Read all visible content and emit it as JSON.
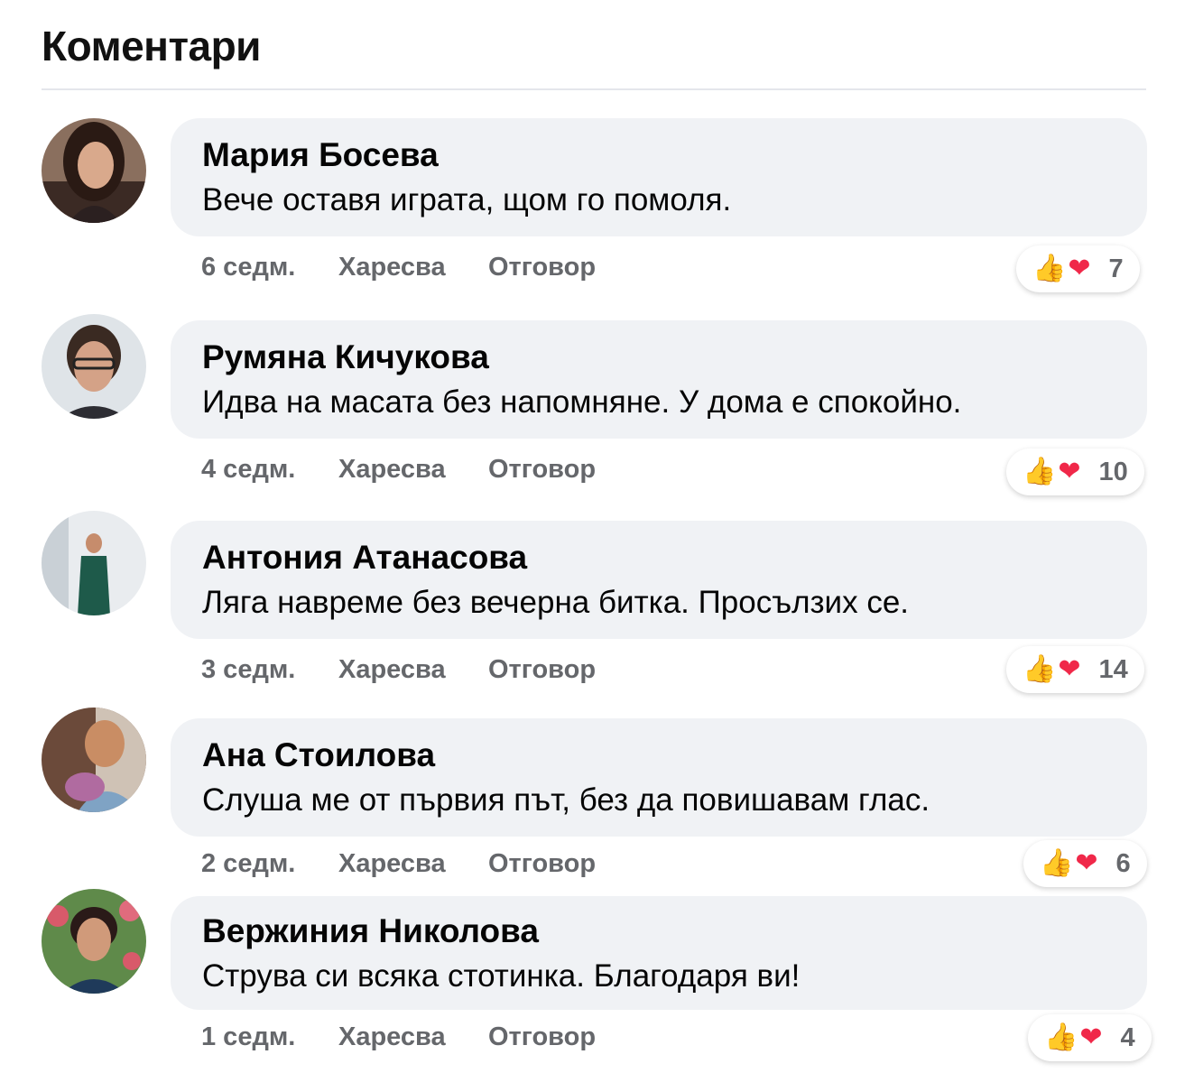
{
  "header": {
    "title": "Коментари"
  },
  "labels": {
    "like": "Харесва",
    "reply": "Отговор"
  },
  "comments": [
    {
      "author": "Мария Босева",
      "text": "Вече оставя играта, щом го помоля.",
      "time": "6 седм.",
      "reactions": {
        "count": "7",
        "icons": [
          "thumbs-up",
          "heart"
        ]
      }
    },
    {
      "author": "Румяна Кичукова",
      "text": "Идва на масата без напомняне. У дома е спокойно.",
      "time": "4 седм.",
      "reactions": {
        "count": "10",
        "icons": [
          "thumbs-up",
          "heart"
        ]
      }
    },
    {
      "author": "Антония Атанасова",
      "text": "Ляга навреме без вечерна битка. Просълзих се.",
      "time": "3 седм.",
      "reactions": {
        "count": "14",
        "icons": [
          "thumbs-up",
          "heart"
        ]
      }
    },
    {
      "author": "Ана Стоилова",
      "text": "Слуша ме от първия път, без да повишавам глас.",
      "time": "2 седм.",
      "reactions": {
        "count": "6",
        "icons": [
          "thumbs-up",
          "heart"
        ]
      }
    },
    {
      "author": "Вержиния Николова",
      "text": "Струва си всяка стотинка. Благодаря ви!",
      "time": "1 седм.",
      "reactions": {
        "count": "4",
        "icons": [
          "thumbs-up",
          "heart"
        ]
      }
    }
  ]
}
